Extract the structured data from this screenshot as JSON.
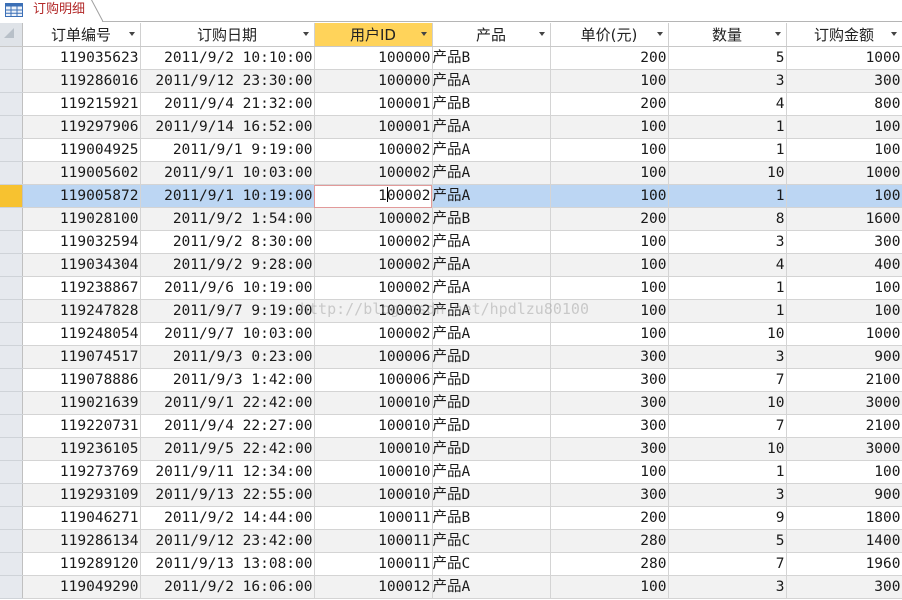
{
  "tab": {
    "title": "订购明细",
    "icon": "table-icon"
  },
  "columns": [
    {
      "key": "order_no",
      "label": "订单编号"
    },
    {
      "key": "date",
      "label": "订购日期"
    },
    {
      "key": "user_id",
      "label": "用户ID"
    },
    {
      "key": "product",
      "label": "产品"
    },
    {
      "key": "price",
      "label": "单价(元)"
    },
    {
      "key": "qty",
      "label": "数量"
    },
    {
      "key": "amount",
      "label": "订购金额"
    }
  ],
  "selected_column": "user_id",
  "current_row_index": 6,
  "current_cell_value": "100002",
  "rows": [
    [
      "119035623",
      "2011/9/2 10:10:00",
      "100000",
      "产品B",
      "200",
      "5",
      "1000"
    ],
    [
      "119286016",
      "2011/9/12 23:30:00",
      "100000",
      "产品A",
      "100",
      "3",
      "300"
    ],
    [
      "119215921",
      "2011/9/4 21:32:00",
      "100001",
      "产品B",
      "200",
      "4",
      "800"
    ],
    [
      "119297906",
      "2011/9/14 16:52:00",
      "100001",
      "产品A",
      "100",
      "1",
      "100"
    ],
    [
      "119004925",
      "2011/9/1 9:19:00",
      "100002",
      "产品A",
      "100",
      "1",
      "100"
    ],
    [
      "119005602",
      "2011/9/1 10:03:00",
      "100002",
      "产品A",
      "100",
      "10",
      "1000"
    ],
    [
      "119005872",
      "2011/9/1 10:19:00",
      "100002",
      "产品A",
      "100",
      "1",
      "100"
    ],
    [
      "119028100",
      "2011/9/2 1:54:00",
      "100002",
      "产品B",
      "200",
      "8",
      "1600"
    ],
    [
      "119032594",
      "2011/9/2 8:30:00",
      "100002",
      "产品A",
      "100",
      "3",
      "300"
    ],
    [
      "119034304",
      "2011/9/2 9:28:00",
      "100002",
      "产品A",
      "100",
      "4",
      "400"
    ],
    [
      "119238867",
      "2011/9/6 10:19:00",
      "100002",
      "产品A",
      "100",
      "1",
      "100"
    ],
    [
      "119247828",
      "2011/9/7 9:19:00",
      "100002",
      "产品A",
      "100",
      "1",
      "100"
    ],
    [
      "119248054",
      "2011/9/7 10:03:00",
      "100002",
      "产品A",
      "100",
      "10",
      "1000"
    ],
    [
      "119074517",
      "2011/9/3 0:23:00",
      "100006",
      "产品D",
      "300",
      "3",
      "900"
    ],
    [
      "119078886",
      "2011/9/3 1:42:00",
      "100006",
      "产品D",
      "300",
      "7",
      "2100"
    ],
    [
      "119021639",
      "2011/9/1 22:42:00",
      "100010",
      "产品D",
      "300",
      "10",
      "3000"
    ],
    [
      "119220731",
      "2011/9/4 22:27:00",
      "100010",
      "产品D",
      "300",
      "7",
      "2100"
    ],
    [
      "119236105",
      "2011/9/5 22:42:00",
      "100010",
      "产品D",
      "300",
      "10",
      "3000"
    ],
    [
      "119273769",
      "2011/9/11 12:34:00",
      "100010",
      "产品A",
      "100",
      "1",
      "100"
    ],
    [
      "119293109",
      "2011/9/13 22:55:00",
      "100010",
      "产品D",
      "300",
      "3",
      "900"
    ],
    [
      "119046271",
      "2011/9/2 14:44:00",
      "100011",
      "产品B",
      "200",
      "9",
      "1800"
    ],
    [
      "119286134",
      "2011/9/12 23:42:00",
      "100011",
      "产品C",
      "280",
      "5",
      "1400"
    ],
    [
      "119289120",
      "2011/9/13 13:08:00",
      "100011",
      "产品C",
      "280",
      "7",
      "1960"
    ],
    [
      "119049290",
      "2011/9/2 16:06:00",
      "100012",
      "产品A",
      "100",
      "3",
      "300"
    ]
  ],
  "watermark": "http://blog.csdn.net/hpdlzu80100",
  "colors": {
    "selected_header": "#ffd35a",
    "current_row": "#bcd6f3",
    "row_selector_current": "#f7c230",
    "tab_title": "#b22828"
  }
}
